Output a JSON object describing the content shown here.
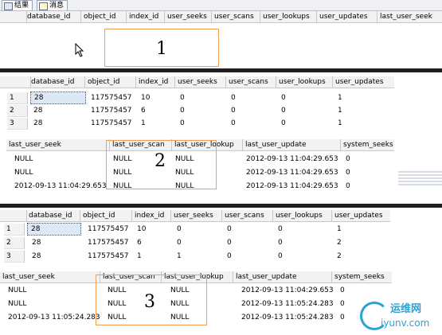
{
  "tabs": [
    {
      "label": "结果",
      "icon": "grid-icon"
    },
    {
      "label": "消息",
      "icon": "message-icon"
    }
  ],
  "panel1": {
    "columns": [
      "database_id",
      "object_id",
      "index_id",
      "user_seeks",
      "user_scans",
      "user_lookups",
      "user_updates",
      "last_user_seek"
    ],
    "marker": "1"
  },
  "panel2": {
    "columns": [
      "database_id",
      "object_id",
      "index_id",
      "user_seeks",
      "user_scans",
      "user_lookups",
      "user_updates"
    ],
    "rows": [
      [
        "1",
        "28",
        "117575457",
        "10",
        "0",
        "0",
        "0",
        "1"
      ],
      [
        "2",
        "28",
        "117575457",
        "6",
        "0",
        "0",
        "0",
        "1"
      ],
      [
        "3",
        "28",
        "117575457",
        "1",
        "0",
        "0",
        "0",
        "1"
      ]
    ],
    "columns2": [
      "last_user_seek",
      "last_user_scan",
      "last_user_lookup",
      "last_user_update",
      "system_seeks"
    ],
    "rows2": [
      [
        "NULL",
        "NULL",
        "NULL",
        "2012-09-13 11:04:29.653",
        "0"
      ],
      [
        "NULL",
        "NULL",
        "NULL",
        "2012-09-13 11:04:29.653",
        "0"
      ],
      [
        "2012-09-13 11:04:29.653",
        "NULL",
        "NULL",
        "2012-09-13 11:04:29.653",
        "0"
      ]
    ],
    "marker": "2"
  },
  "panel3": {
    "columns": [
      "database_id",
      "object_id",
      "index_id",
      "user_seeks",
      "user_scans",
      "user_lookups",
      "user_updates"
    ],
    "rows": [
      [
        "1",
        "28",
        "117575457",
        "10",
        "0",
        "0",
        "0",
        "1"
      ],
      [
        "2",
        "28",
        "117575457",
        "6",
        "0",
        "0",
        "0",
        "2"
      ],
      [
        "3",
        "28",
        "117575457",
        "1",
        "1",
        "0",
        "0",
        "2"
      ]
    ],
    "columns2": [
      "last_user_seek",
      "last_user_scan",
      "last_user_lookup",
      "last_user_update",
      "system_seeks"
    ],
    "rows2": [
      [
        "NULL",
        "NULL",
        "NULL",
        "2012-09-13 11:04:29.653",
        "0"
      ],
      [
        "NULL",
        "NULL",
        "NULL",
        "2012-09-13 11:05:24.283",
        "0"
      ],
      [
        "2012-09-13 11:05:24.283",
        "NULL",
        "NULL",
        "2012-09-13 11:05:24.283",
        "0"
      ]
    ],
    "marker": "3"
  },
  "watermark": {
    "text_cn": "运维网",
    "text_url": "iyunv.com",
    "color": "#29a3d6"
  },
  "colors": {
    "highlight_box": "#f0a050",
    "header_bg": "#f2f2f2"
  }
}
